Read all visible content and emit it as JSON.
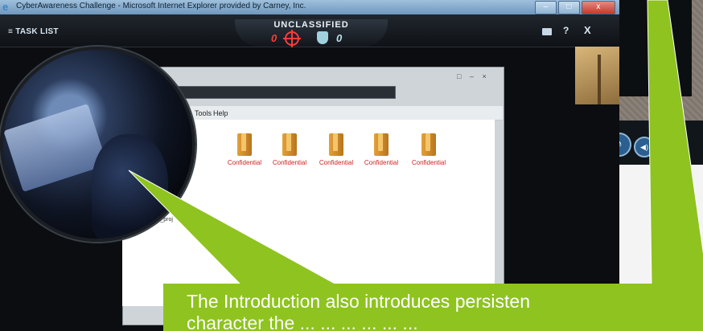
{
  "window": {
    "title": "CyberAwareness Challenge - Microsoft Internet Explorer provided by Carney, Inc."
  },
  "game": {
    "task_list_label": "≡ TASK LIST",
    "classification": "UNCLASSIFIED",
    "score_left": "0",
    "score_right": "0"
  },
  "explorer": {
    "menu_tools": "Tools",
    "menu_help": "Help",
    "folders": [
      "Confidential",
      "Confidential",
      "Confidential",
      "Confidential",
      "Confidential"
    ],
    "sidebar_item": "Current_proj"
  },
  "caption": {
    "line1": "The Introduction also introduces persisten",
    "line2": "character the ... ... ... ... ... ..."
  },
  "colors": {
    "callout_green": "#8fc31f",
    "folder_label_red": "#d11f1f",
    "score_red": "#ff3b3b"
  }
}
